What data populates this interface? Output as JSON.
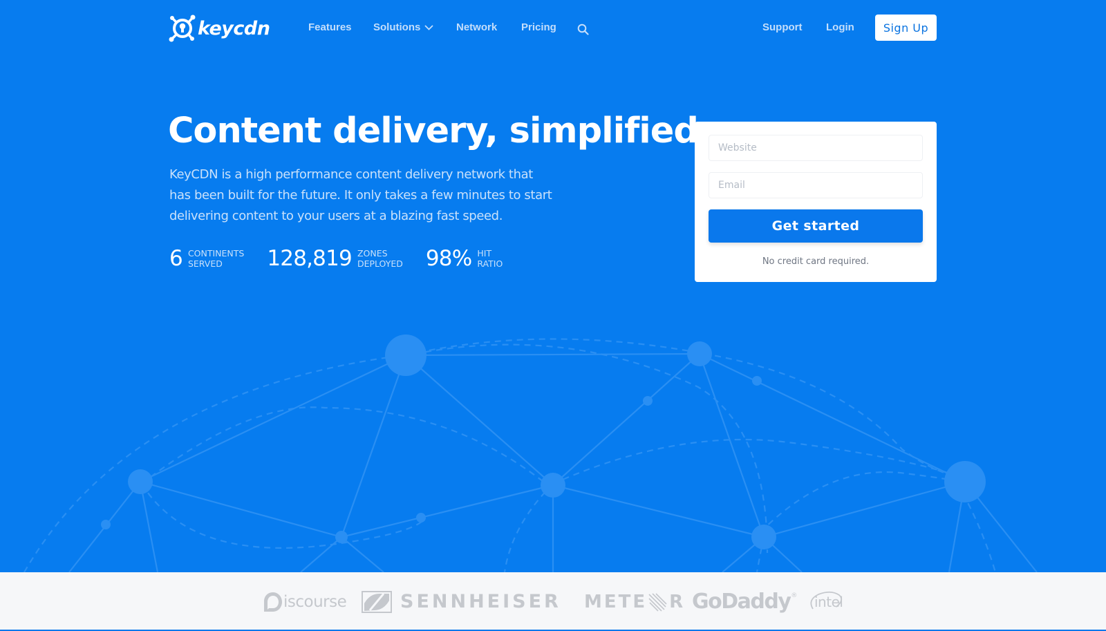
{
  "nav": {
    "logo_text": "keycdn",
    "links": [
      {
        "label": "Features"
      },
      {
        "label": "Solutions",
        "has_dropdown": true
      },
      {
        "label": "Network"
      },
      {
        "label": "Pricing"
      }
    ],
    "search_icon": "search-icon",
    "right_links": [
      {
        "label": "Support"
      },
      {
        "label": "Login"
      }
    ],
    "signup_label": "Sign Up"
  },
  "hero": {
    "headline": "Content delivery, simplified.",
    "subtext": "KeyCDN is a high performance content delivery network that has been built for the future. It only takes a few minutes to start delivering content to your users at a blazing fast speed.",
    "stats": [
      {
        "value": "6",
        "label_line1": "Continents",
        "label_line2": "Served"
      },
      {
        "value": "128,819",
        "label_line1": "Zones",
        "label_line2": "Deployed"
      },
      {
        "value": "98%",
        "label_line1": "Hit",
        "label_line2": "Ratio"
      }
    ]
  },
  "signup_form": {
    "website_placeholder": "Website",
    "website_value": "",
    "email_placeholder": "Email",
    "email_value": "",
    "submit_label": "Get started",
    "note": "No credit card required."
  },
  "clients": {
    "logos": [
      {
        "name": "Discourse",
        "text": "iscourse"
      },
      {
        "name": "Sennheiser",
        "text": "SENNHEISER"
      },
      {
        "name": "Meteor",
        "text_a": "METE",
        "text_b": "R"
      },
      {
        "name": "GoDaddy",
        "text": "GoDaddy",
        "mark": "®"
      },
      {
        "name": "Intel",
        "text": "intel"
      }
    ]
  },
  "colors": {
    "hero_bg": "#077cef",
    "accent": "#0a78ec",
    "nav_link": "#c4defb",
    "client_logo_gray": "#c5c8cd",
    "clients_bg": "#f6f7f9",
    "network_lines": "#2a8ff3"
  }
}
